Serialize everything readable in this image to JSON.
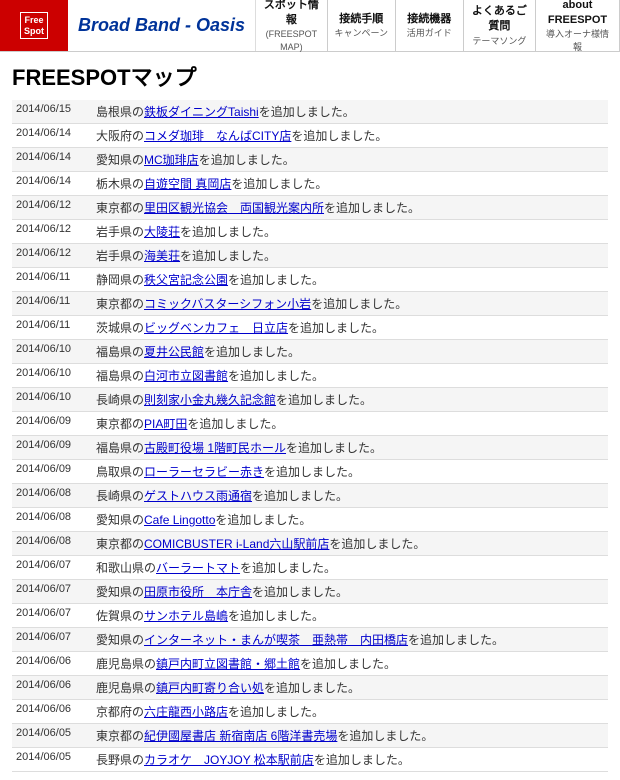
{
  "header": {
    "logo_line1": "Free",
    "logo_line2": "Spot",
    "brand": "Broad Band - Oasis",
    "nav": [
      {
        "main": "スポット情報",
        "sub": "(FREESPOT MAP)",
        "id": "spot"
      },
      {
        "main": "接続手順",
        "sub": "キャンペーン",
        "id": "connect"
      },
      {
        "main": "接続機器",
        "sub": "活用ガイド",
        "id": "device"
      },
      {
        "main": "よくあるご質問",
        "sub": "テーマソング",
        "id": "faq"
      },
      {
        "main": "about FREESPOT",
        "sub": "導入オーナ様情報",
        "id": "about"
      }
    ]
  },
  "page": {
    "title": "FREESPOTマップ"
  },
  "news": [
    {
      "date": "2014/06/15",
      "html": "島根県の<a href='#'>鉄板ダイニングTaishi</a>を追加しました。"
    },
    {
      "date": "2014/06/14",
      "html": "大阪府の<a href='#'>コメダ珈琲　なんばCITY店</a>を追加しました。"
    },
    {
      "date": "2014/06/14",
      "html": "愛知県の<a href='#'>MC珈琲店</a>を追加しました。"
    },
    {
      "date": "2014/06/14",
      "html": "栃木県の<a href='#'>自遊空間 真岡店</a>を追加しました。"
    },
    {
      "date": "2014/06/12",
      "html": "東京都の<a href='#'>里田区観光協会　両国観光案内所</a>を追加しました。"
    },
    {
      "date": "2014/06/12",
      "html": "岩手県の<a href='#'>大陵荘</a>を追加しました。"
    },
    {
      "date": "2014/06/12",
      "html": "岩手県の<a href='#'>海美荘</a>を追加しました。"
    },
    {
      "date": "2014/06/11",
      "html": "静岡県の<a href='#'>秩父宮記念公園</a>を追加しました。"
    },
    {
      "date": "2014/06/11",
      "html": "東京都の<a href='#'>コミックバスターシフォン小岩</a>を追加しました。"
    },
    {
      "date": "2014/06/11",
      "html": "茨城県の<a href='#'>ビッグベンカフェ　日立店</a>を追加しました。"
    },
    {
      "date": "2014/06/10",
      "html": "福島県の<a href='#'>夏井公民館</a>を追加しました。"
    },
    {
      "date": "2014/06/10",
      "html": "福島県の<a href='#'>白河市立図書館</a>を追加しました。"
    },
    {
      "date": "2014/06/10",
      "html": "長崎県の<a href='#'>則刻家小金丸幾久記念館</a>を追加しました。"
    },
    {
      "date": "2014/06/09",
      "html": "東京都の<a href='#'>PIA町田</a>を追加しました。"
    },
    {
      "date": "2014/06/09",
      "html": "福島県の<a href='#'>古殿町役場 1階町民ホール</a>を追加しました。"
    },
    {
      "date": "2014/06/09",
      "html": "鳥取県の<a href='#'>ローラーセラビー赤き</a>を追加しました。"
    },
    {
      "date": "2014/06/08",
      "html": "長崎県の<a href='#'>ゲストハウス雨通宿</a>を追加しました。"
    },
    {
      "date": "2014/06/08",
      "html": "愛知県の<a href='#'>Cafe Lingotto</a>を追加しました。"
    },
    {
      "date": "2014/06/08",
      "html": "東京都の<a href='#'>COMICBUSTER i-Land六山駅前店</a>を追加しました。"
    },
    {
      "date": "2014/06/07",
      "html": "和歌山県の<a href='#'>バーラートマト</a>を追加しました。"
    },
    {
      "date": "2014/06/07",
      "html": "愛知県の<a href='#'>田原市役所　本庁舎</a>を追加しました。"
    },
    {
      "date": "2014/06/07",
      "html": "佐賀県の<a href='#'>サンホテル島嶋</a>を追加しました。"
    },
    {
      "date": "2014/06/07",
      "html": "愛知県の<a href='#'>インターネット・まんが喫茶　亜熱帯　内田橋店</a>を追加しました。"
    },
    {
      "date": "2014/06/06",
      "html": "鹿児島県の<a href='#'>鎮戸内町立図書館・郷土館</a>を追加しました。"
    },
    {
      "date": "2014/06/06",
      "html": "鹿児島県の<a href='#'>鎮戸内町寄り合い処</a>を追加しました。"
    },
    {
      "date": "2014/06/06",
      "html": "京都府の<a href='#'>六庄龍西小路店</a>を追加しました。"
    },
    {
      "date": "2014/06/05",
      "html": "東京都の<a href='#'>紀伊國屋書店 新宿南店 6階洋書売場</a>を追加しました。"
    },
    {
      "date": "2014/06/05",
      "html": "長野県の<a href='#'>カラオケ　JOYJOY 松本駅前店</a>を追加しました。"
    }
  ]
}
